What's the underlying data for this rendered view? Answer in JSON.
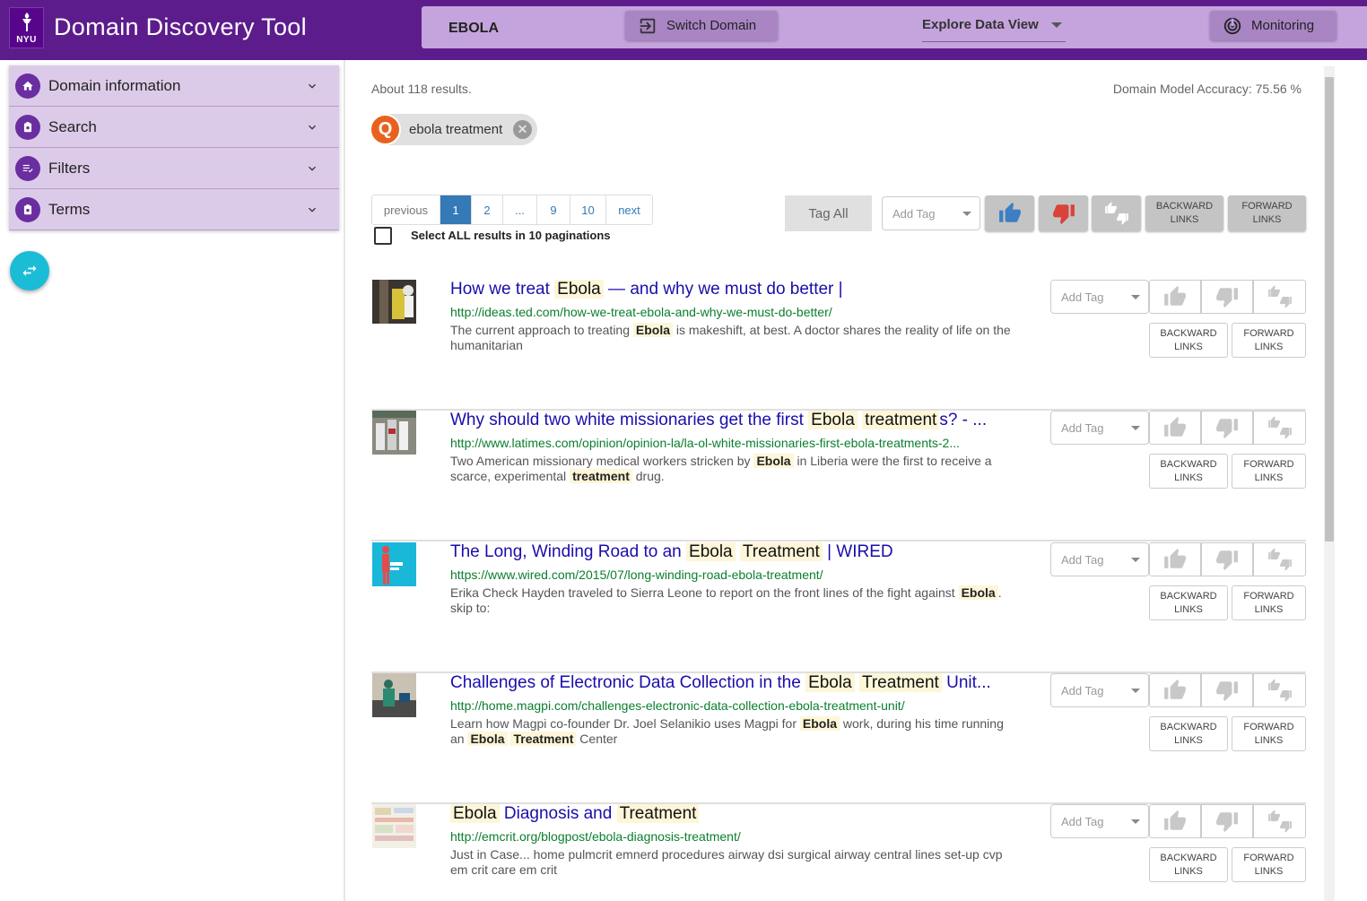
{
  "app": {
    "title": "Domain Discovery Tool",
    "logo_text": "NYU"
  },
  "header": {
    "domain": "EBOLA",
    "switch_label": "Switch Domain",
    "view_label": "Explore Data View",
    "monitoring_label": "Monitoring"
  },
  "sidebar": {
    "items": [
      {
        "label": "Domain information",
        "icon": "home-icon"
      },
      {
        "label": "Search",
        "icon": "search-badge-icon"
      },
      {
        "label": "Filters",
        "icon": "filter-list-icon"
      },
      {
        "label": "Terms",
        "icon": "terms-badge-icon"
      }
    ]
  },
  "summary": {
    "results": "About 118 results.",
    "accuracy": "Domain Model Accuracy: 75.56 %"
  },
  "query_chip": {
    "avatar": "Q",
    "label": "ebola treatment"
  },
  "pagination": {
    "previous": "previous",
    "pages": [
      "1",
      "2",
      "...",
      "9",
      "10"
    ],
    "active": "1",
    "next": "next",
    "select_all": "Select ALL results in 10 paginations"
  },
  "bulk": {
    "tag_all": "Tag All",
    "add_tag": "Add Tag",
    "backward": "BACKWARD LINKS",
    "forward": "FORWARD LINKS"
  },
  "colors": {
    "header": "#5d1c8c",
    "panel": "#c5a4dd",
    "thumb_up": "#3d7fc4",
    "thumb_down": "#d9433a",
    "link": "#1a0dab",
    "url": "#0a7f2e"
  },
  "results": [
    {
      "title_parts": [
        "How we treat ",
        "Ebola",
        " — and why we must do better |"
      ],
      "url": "http://ideas.ted.com/how-we-treat-ebola-and-why-we-must-do-better/",
      "snippet_parts": [
        "The current approach to treating ",
        "Ebola",
        " is makeshift, at best. A doctor shares the reality of life on the humanitarian"
      ]
    },
    {
      "title_parts": [
        "Why should two white missionaries get the first ",
        "Ebola",
        " ",
        "treatment",
        "s? - ..."
      ],
      "url": "http://www.latimes.com/opinion/opinion-la/la-ol-white-missionaries-first-ebola-treatments-2...",
      "snippet_parts": [
        "Two American missionary medical workers stricken by ",
        "Ebola",
        " in Liberia were the first to receive a scarce, experimental ",
        "treatment",
        " drug."
      ]
    },
    {
      "title_parts": [
        "The Long, Winding Road to an ",
        "Ebola",
        " ",
        "Treatment",
        " | WIRED"
      ],
      "url": "https://www.wired.com/2015/07/long-winding-road-ebola-treatment/",
      "snippet_parts": [
        "Erika Check Hayden traveled to Sierra Leone to report on the front lines of the fight against ",
        "Ebola",
        ". skip to:"
      ]
    },
    {
      "title_parts": [
        "Challenges of Electronic Data Collection in the ",
        "Ebola",
        " ",
        "Treatment",
        " Unit..."
      ],
      "url": "http://home.magpi.com/challenges-electronic-data-collection-ebola-treatment-unit/",
      "snippet_parts": [
        "Learn how Magpi co-founder Dr. Joel Selanikio uses Magpi for ",
        "Ebola",
        " work, during his time running an ",
        "Ebola",
        " ",
        "Treatment",
        " Center"
      ]
    },
    {
      "title_parts": [
        "",
        "Ebola",
        " Diagnosis and ",
        "Treatment",
        ""
      ],
      "url": "http://emcrit.org/blogpost/ebola-diagnosis-treatment/",
      "snippet_parts": [
        "Just in Case... home pulmcrit emnerd procedures airway dsi surgical airway central lines set-up cvp em crit care em crit"
      ]
    }
  ]
}
